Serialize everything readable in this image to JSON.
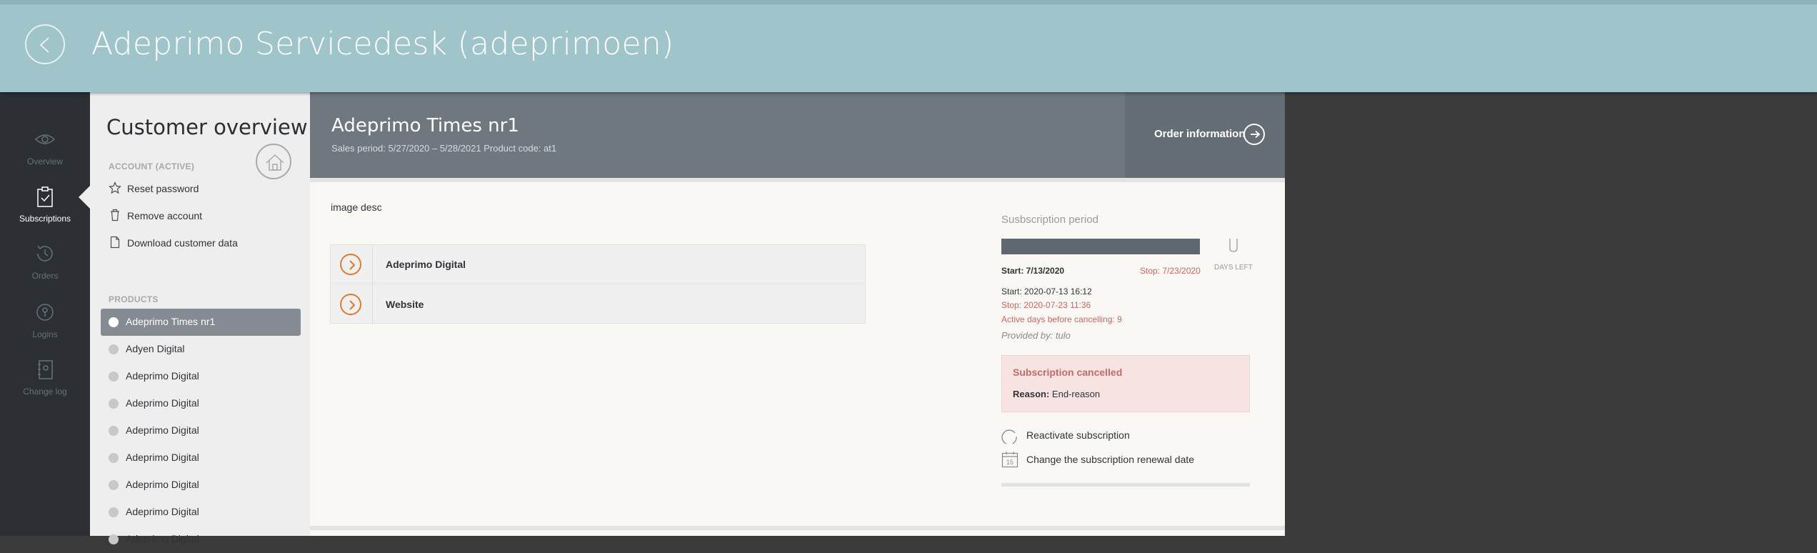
{
  "header": {
    "title": "Adeprimo Servicedesk (adeprimoen)",
    "back_icon": "chevron-left-icon"
  },
  "rail": {
    "items": [
      {
        "label": "Overview",
        "icon": "eye-icon",
        "active": false
      },
      {
        "label": "Subscriptions",
        "icon": "clipboard-check-icon",
        "active": true
      },
      {
        "label": "Orders",
        "icon": "history-icon",
        "active": false
      },
      {
        "label": "Logins",
        "icon": "key-icon",
        "active": false
      },
      {
        "label": "Change log",
        "icon": "log-book-icon",
        "active": false
      }
    ]
  },
  "panel": {
    "title": "Customer overview",
    "account_heading": "ACCOUNT (ACTIVE)",
    "actions": [
      {
        "label": "Reset password",
        "icon": "star-icon"
      },
      {
        "label": "Remove account",
        "icon": "trash-icon"
      },
      {
        "label": "Download customer data",
        "icon": "document-icon"
      }
    ],
    "products_heading": "PRODUCTS",
    "products": [
      {
        "label": "Adeprimo Times nr1",
        "active": true
      },
      {
        "label": "Adyen Digital",
        "active": false
      },
      {
        "label": "Adeprimo Digital",
        "active": false
      },
      {
        "label": "Adeprimo Digital",
        "active": false
      },
      {
        "label": "Adeprimo Digital",
        "active": false
      },
      {
        "label": "Adeprimo Digital",
        "active": false
      },
      {
        "label": "Adeprimo Digital",
        "active": false
      },
      {
        "label": "Adeprimo Digital",
        "active": false
      },
      {
        "label": "Adeprimo Digital",
        "active": false
      }
    ]
  },
  "main": {
    "product_title": "Adeprimo Times nr1",
    "product_subtitle": "Sales period: 5/27/2020 – 5/28/2021 Product code: at1",
    "order_info_label": "Order information",
    "image_desc": "image desc",
    "links": [
      {
        "label": "Adeprimo Digital"
      },
      {
        "label": "Website"
      }
    ]
  },
  "subscription": {
    "title": "Susbscription period",
    "progress": 1.0,
    "start_label": "Start: 7/13/2020",
    "stop_label": "Stop: 7/23/2020",
    "days_left_value": "0",
    "days_left_label": "DAYS LEFT",
    "start_detail": "Start: 2020-07-13 16:12",
    "stop_detail": "Stop: 2020-07-23 11:36",
    "active_days": "Active days before cancelling: 9",
    "provided_by": "Provided by: tulo",
    "cancelled_title": "Subscription cancelled",
    "reason_label": "Reason:",
    "reason_value": "End-reason",
    "reactivate_label": "Reactivate subscription",
    "change_date_label": "Change the subscription renewal date",
    "calendar_day": "15"
  },
  "colors": {
    "header_bg": "#9fc4ca",
    "rail_bg": "#2c3035",
    "accent_orange": "#e07a2e",
    "cancel_red": "#c56a66"
  }
}
